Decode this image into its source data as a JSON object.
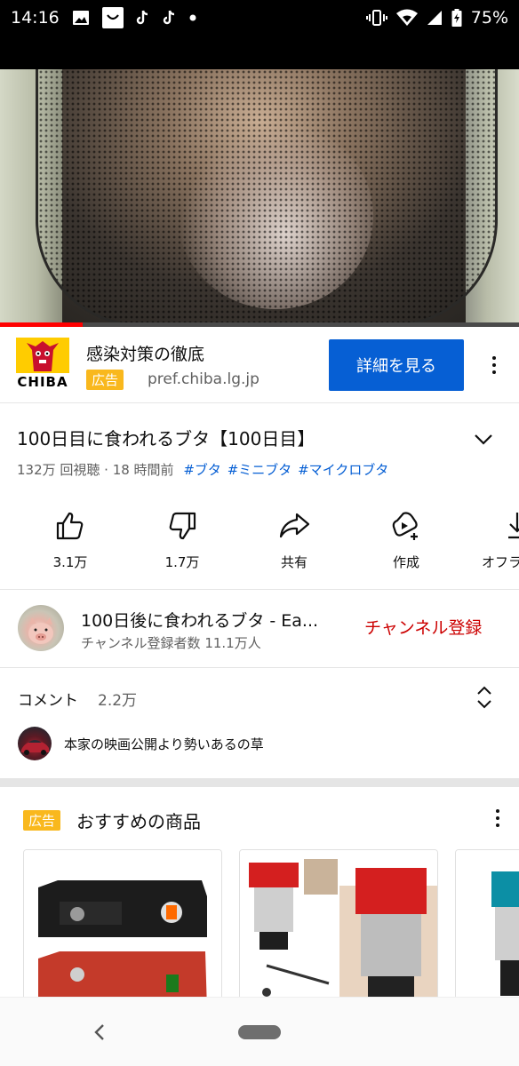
{
  "status_bar": {
    "time": "14:16",
    "battery": "75%"
  },
  "video": {
    "progress": 0.16
  },
  "ad": {
    "logo_text": "CHIBA",
    "title": "感染対策の徹底",
    "badge": "広告",
    "url": "pref.chiba.lg.jp",
    "cta": "詳細を見る"
  },
  "video_info": {
    "title": "100日目に食われるブタ【100日目】",
    "stats": "132万 回視聴 · 18 時間前",
    "hashtags": [
      "#ブタ",
      "#ミニブタ",
      "#マイクロブタ"
    ]
  },
  "actions": [
    {
      "label": "3.1万",
      "icon": "thumbs-up-icon"
    },
    {
      "label": "1.7万",
      "icon": "thumbs-down-icon"
    },
    {
      "label": "共有",
      "icon": "share-icon"
    },
    {
      "label": "作成",
      "icon": "create-icon"
    },
    {
      "label": "オフラ",
      "icon": "download-icon"
    }
  ],
  "channel": {
    "name": "100日後に食われるブタ - Ea...",
    "subscribers": "チャンネル登録者数 11.1万人",
    "subscribe_label": "チャンネル登録"
  },
  "comments": {
    "label": "コメント",
    "count": "2.2万",
    "top_comment": "本家の映画公開より勢いあるの草"
  },
  "shopping": {
    "badge": "広告",
    "title": "おすすめの商品"
  },
  "colors": {
    "accent": "#065fd4",
    "subscribe": "#cc0000",
    "progress": "#ff0000",
    "ad_badge": "#f9b81d"
  }
}
